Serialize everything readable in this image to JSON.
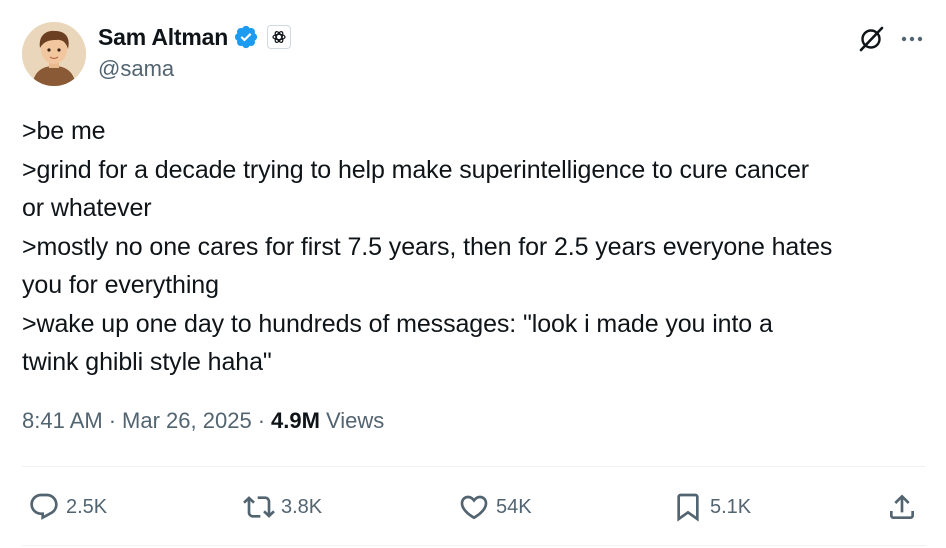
{
  "author": {
    "display_name": "Sam Altman",
    "handle": "@sama",
    "verified": true
  },
  "tweet": {
    "lines": [
      ">be me",
      ">grind for a decade trying to help make superintelligence to cure cancer",
      "or whatever",
      ">mostly no one cares for first 7.5 years, then for 2.5 years everyone hates",
      "you for everything",
      ">wake up one day to hundreds of messages: \"look i made you into a",
      "twink ghibli style haha\""
    ]
  },
  "meta": {
    "time": "8:41 AM",
    "separator": "·",
    "date": "Mar 26, 2025",
    "views_count": "4.9M",
    "views_label": "Views"
  },
  "actions": {
    "reply": "2.5K",
    "retweet": "3.8K",
    "like": "54K",
    "bookmark": "5.1K"
  },
  "colors": {
    "text": "#0f1419",
    "secondary": "#536471",
    "verified": "#1d9bf0",
    "divider": "#eff3f4"
  }
}
